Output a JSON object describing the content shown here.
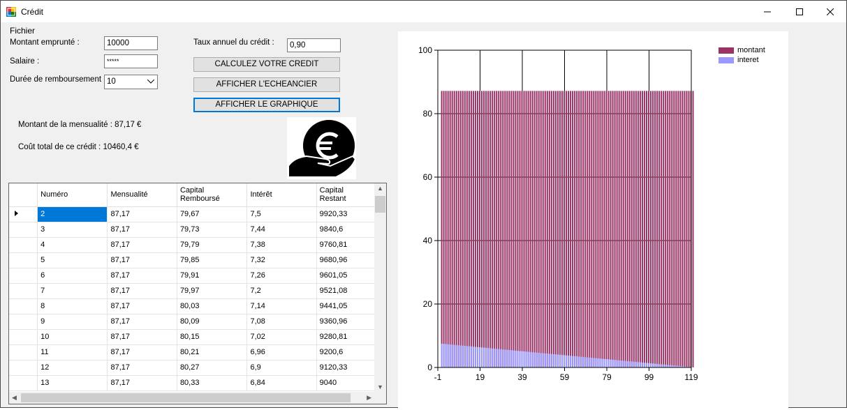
{
  "window": {
    "title": "Crédit"
  },
  "menu": {
    "file_label": "Fichier"
  },
  "form": {
    "montant_label": "Montant emprunté :",
    "montant_value": "10000",
    "salaire_label": "Salaire :",
    "salaire_value": "*****",
    "duree_label": "Durée de remboursement :",
    "duree_value": "10",
    "taux_label": "Taux annuel du crédit :",
    "taux_value": "0,90"
  },
  "buttons": {
    "calculate": "CALCULEZ VOTRE CREDIT",
    "schedule": "AFFICHER L'ECHEANCIER",
    "graph": "AFFICHER LE GRAPHIQUE"
  },
  "results": {
    "monthly": "Montant de la mensualité : 87,17 €",
    "total": "Coût total de ce crédit : 10460,4 €"
  },
  "grid": {
    "columns": [
      [
        "Numéro"
      ],
      [
        "Mensualité"
      ],
      [
        "Capital",
        "Remboursé"
      ],
      [
        "Intérêt"
      ],
      [
        "Capital",
        "Restant"
      ]
    ],
    "rows": [
      [
        "2",
        "87,17",
        "79,67",
        "7,5",
        "9920,33"
      ],
      [
        "3",
        "87,17",
        "79,73",
        "7,44",
        "9840,6"
      ],
      [
        "4",
        "87,17",
        "79,79",
        "7,38",
        "9760,81"
      ],
      [
        "5",
        "87,17",
        "79,85",
        "7,32",
        "9680,96"
      ],
      [
        "6",
        "87,17",
        "79,91",
        "7,26",
        "9601,05"
      ],
      [
        "7",
        "87,17",
        "79,97",
        "7,2",
        "9521,08"
      ],
      [
        "8",
        "87,17",
        "80,03",
        "7,14",
        "9441,05"
      ],
      [
        "9",
        "87,17",
        "80,09",
        "7,08",
        "9360,96"
      ],
      [
        "10",
        "87,17",
        "80,15",
        "7,02",
        "9280,81"
      ],
      [
        "11",
        "87,17",
        "80,21",
        "6,96",
        "9200,6"
      ],
      [
        "12",
        "87,17",
        "80,27",
        "6,9",
        "9120,33"
      ],
      [
        "13",
        "87,17",
        "80,33",
        "6,84",
        "9040"
      ]
    ],
    "selected_row": 0
  },
  "colors": {
    "montant": "#993366",
    "interet": "#9999ff",
    "selection": "#0078d7"
  },
  "chart_data": {
    "type": "bar",
    "series": [
      {
        "name": "montant",
        "values_description": "constant monthly payment per period",
        "value": 87.17
      },
      {
        "name": "interet",
        "start": 7.5,
        "end": 0.06
      }
    ],
    "x_ticks": [
      "-1",
      "19",
      "39",
      "59",
      "79",
      "99",
      "119"
    ],
    "y_ticks": [
      "0",
      "20",
      "40",
      "60",
      "80",
      "100"
    ],
    "xlim": [
      -1,
      119
    ],
    "ylim": [
      0,
      100
    ],
    "periods": [
      1,
      120
    ],
    "grid": true,
    "legend": "top-right"
  }
}
